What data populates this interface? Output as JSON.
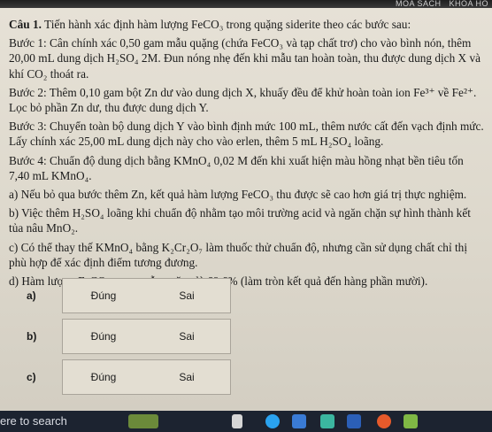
{
  "topbar": {
    "item1": "MOA SACH",
    "item2": "KHOA HO"
  },
  "question": {
    "title": "Câu 1.",
    "intro": "Tiến hành xác định hàm lượng FeCO₃ trong quặng siderite theo các bước sau:",
    "step1": "Bước 1: Cân chính xác 0,50 gam mẫu quặng (chứa FeCO₃ và tạp chất trơ) cho vào bình nón, thêm 20,00 mL dung dịch H₂SO₄ 2M. Đun nóng nhẹ đến khi mẫu tan hoàn toàn, thu được dung dịch X và khí CO₂ thoát ra.",
    "step2": "Bước 2: Thêm 0,10 gam bột Zn dư vào dung dịch X, khuấy đều để khử hoàn toàn ion Fe³⁺ về Fe²⁺. Lọc bỏ phần Zn dư, thu được dung dịch Y.",
    "step3": "Bước 3: Chuyển toàn bộ dung dịch Y vào bình định mức 100 mL, thêm nước cất đến vạch định mức. Lấy chính xác 25,00 mL dung dịch này cho vào erlen, thêm 5 mL H₂SO₄ loãng.",
    "step4": "Bước 4: Chuẩn độ dung dịch bằng KMnO₄ 0,02 M đến khi xuất hiện màu hồng nhạt bền tiêu tốn 7,40 mL KMnO₄.",
    "a": "a) Nếu bỏ qua bước thêm Zn, kết quả hàm lượng FeCO₃ thu được sẽ cao hơn giá trị thực nghiệm.",
    "b": "b) Việc thêm H₂SO₄ loãng khi chuẩn độ nhằm tạo môi trường acid và ngăn chặn sự hình thành kết tủa nâu MnO₂.",
    "c": "c) Có thể thay thế KMnO₄ bằng K₂Cr₂O₇ làm thuốc thử chuẩn độ, nhưng cần sử dụng chất chỉ thị phù hợp để xác định điểm tương đương.",
    "d": "d) Hàm lượng FeCO₃ trong mẫu quặng là 69,6% (làm tròn kết quả đến hàng phần mười)."
  },
  "answers": [
    {
      "label": "a)",
      "true_label": "Đúng",
      "false_label": "Sai"
    },
    {
      "label": "b)",
      "true_label": "Đúng",
      "false_label": "Sai"
    },
    {
      "label": "c)",
      "true_label": "Đúng",
      "false_label": "Sai"
    }
  ],
  "taskbar": {
    "search_text": "ere to search"
  }
}
